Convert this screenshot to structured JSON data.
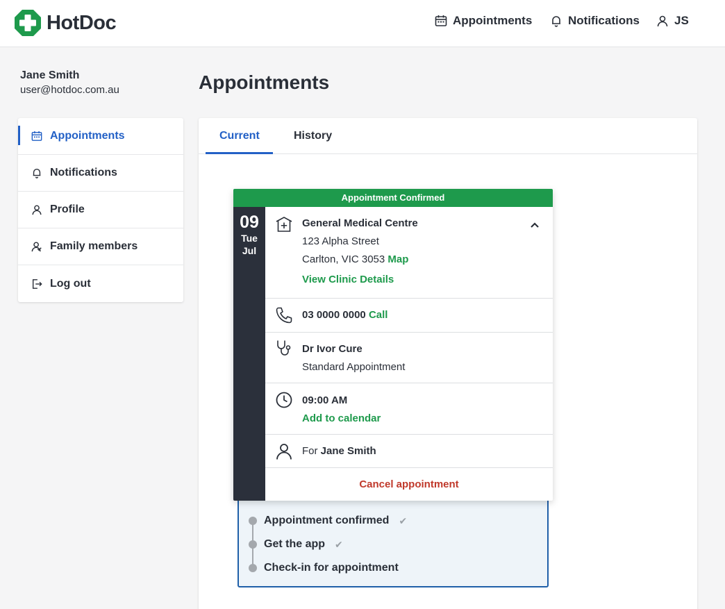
{
  "brand": {
    "name": "HotDoc",
    "color": "#1e9a4c"
  },
  "topnav": {
    "appointments": "Appointments",
    "notifications": "Notifications",
    "user_initials": "JS"
  },
  "user": {
    "name": "Jane Smith",
    "email": "user@hotdoc.com.au"
  },
  "sidebar": {
    "items": [
      {
        "label": "Appointments",
        "icon": "calendar-icon",
        "active": true
      },
      {
        "label": "Notifications",
        "icon": "bell-icon"
      },
      {
        "label": "Profile",
        "icon": "person-icon"
      },
      {
        "label": "Family members",
        "icon": "family-icon"
      },
      {
        "label": "Log out",
        "icon": "logout-icon"
      }
    ]
  },
  "main": {
    "title": "Appointments",
    "tabs": [
      {
        "label": "Current",
        "active": true
      },
      {
        "label": "History"
      }
    ]
  },
  "appointment": {
    "status": "Appointment Confirmed",
    "date": {
      "day": "09",
      "weekday": "Tue",
      "month": "Jul"
    },
    "clinic": {
      "name": "General Medical Centre",
      "street": "123 Alpha Street",
      "suburb": "Carlton, VIC 3053",
      "map_link": "Map",
      "details_link": "View Clinic Details"
    },
    "phone": {
      "number": "03 0000 0000",
      "call_link": "Call"
    },
    "doctor": {
      "name": "Dr Ivor Cure",
      "type": "Standard Appointment"
    },
    "time": {
      "value": "09:00 AM",
      "calendar_link": "Add to calendar"
    },
    "patient": {
      "prefix": "For",
      "name": "Jane Smith"
    },
    "cancel": "Cancel appointment"
  },
  "checklist": [
    {
      "label": "Appointment confirmed",
      "done": true
    },
    {
      "label": "Get the app",
      "done": true
    },
    {
      "label": "Check-in for appointment",
      "done": false
    }
  ],
  "colors": {
    "accent": "#2260c6",
    "success": "#1e9a4c",
    "danger": "#c0392b",
    "dark": "#2b303b"
  }
}
